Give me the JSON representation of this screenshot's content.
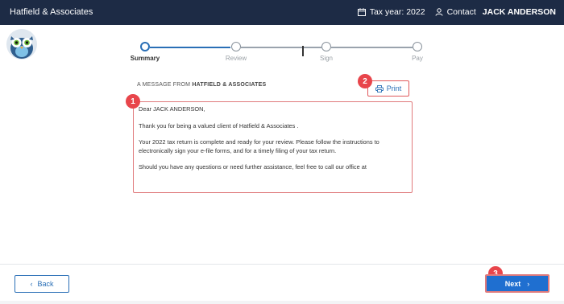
{
  "header": {
    "brand": "Hatfield & Associates",
    "tax_year": "Tax year: 2022",
    "contact": "Contact",
    "user_name": "JACK ANDERSON"
  },
  "stepper": {
    "steps": [
      {
        "label": "Summary",
        "active": true
      },
      {
        "label": "Review",
        "active": false
      },
      {
        "label": "Sign",
        "active": false
      },
      {
        "label": "Pay",
        "active": false
      }
    ]
  },
  "message": {
    "heading_prefix": "A MESSAGE FROM ",
    "heading_firm": "HATFIELD & ASSOCIATES",
    "print_label": "Print",
    "greeting": "Dear JACK ANDERSON,",
    "para1": "Thank you for being a valued client of Hatfield & Associates .",
    "para2": "Your 2022 tax return is complete and ready for your review. Please follow the instructions to electronically sign your e-file forms, and for a timely filing of your tax return.",
    "para3": "Should you have any questions or need further assistance, feel free to call our office at"
  },
  "badges": [
    "1",
    "2",
    "3"
  ],
  "footer": {
    "back_label": "Back",
    "next_label": "Next"
  },
  "colors": {
    "header_bg": "#1d2b45",
    "accent": "#2a6fb6",
    "next_bg": "#1f6fd0",
    "badge": "#e8454b"
  },
  "icons": {
    "calendar": "calendar-icon",
    "contact": "person-icon",
    "print": "printer-icon",
    "back": "chevron-left-icon",
    "next": "chevron-right-icon",
    "avatar": "owl-logo"
  }
}
